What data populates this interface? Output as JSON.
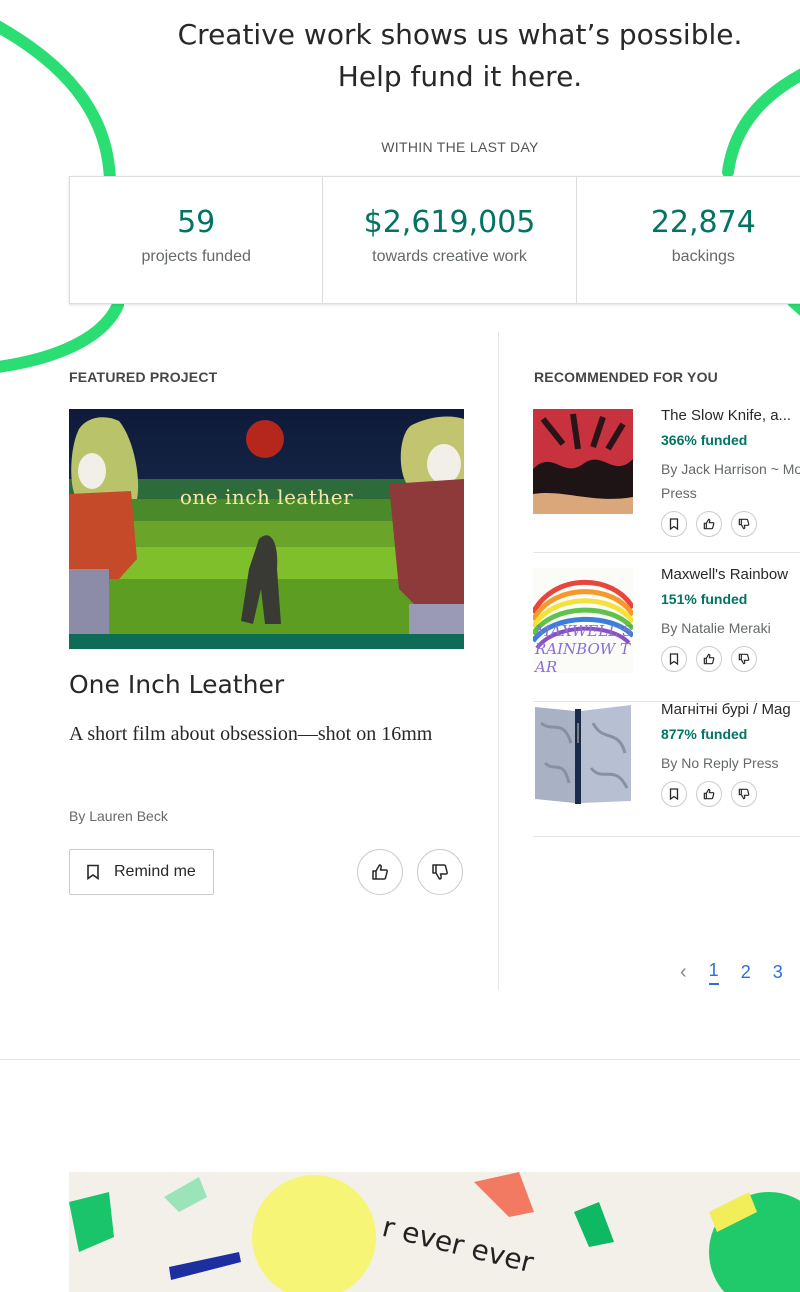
{
  "hero": {
    "title_line1": "Creative work shows us what’s possible.",
    "title_line2": "Help fund it here.",
    "kicker": "WITHIN THE LAST DAY"
  },
  "stats": [
    {
      "value": "59",
      "label": "projects funded"
    },
    {
      "value": "$2,619,005",
      "label": "towards creative work"
    },
    {
      "value": "22,874",
      "label": "backings"
    }
  ],
  "featured": {
    "section_label": "FEATURED PROJECT",
    "image_caption": "one inch leather",
    "title": "One Inch Leather",
    "blurb": "A short film about obsession—shot on 16mm",
    "byline": "By Lauren Beck",
    "remind_label": "Remind me"
  },
  "recommended": {
    "section_label": "RECOMMENDED FOR YOU",
    "items": [
      {
        "title": "The Slow Knife, a...",
        "funded": "366% funded",
        "byline": "By Jack Harrison ~ Mo Press"
      },
      {
        "title": "Maxwell's Rainbow",
        "funded": "151% funded",
        "byline": "By Natalie Meraki",
        "thumb_text": "MAXWELL'S RAINBOW TAR"
      },
      {
        "title": "Магнітні бурі / Mag",
        "funded": "877% funded",
        "byline": "By No Reply Press"
      }
    ]
  },
  "pagination": {
    "prev": "‹",
    "pages": [
      "1",
      "2",
      "3"
    ],
    "current": "1"
  },
  "banner": {
    "text": "r ever ever"
  },
  "colors": {
    "accent": "#037362",
    "brand_green": "#2bde73",
    "link": "#2a6fdb"
  }
}
